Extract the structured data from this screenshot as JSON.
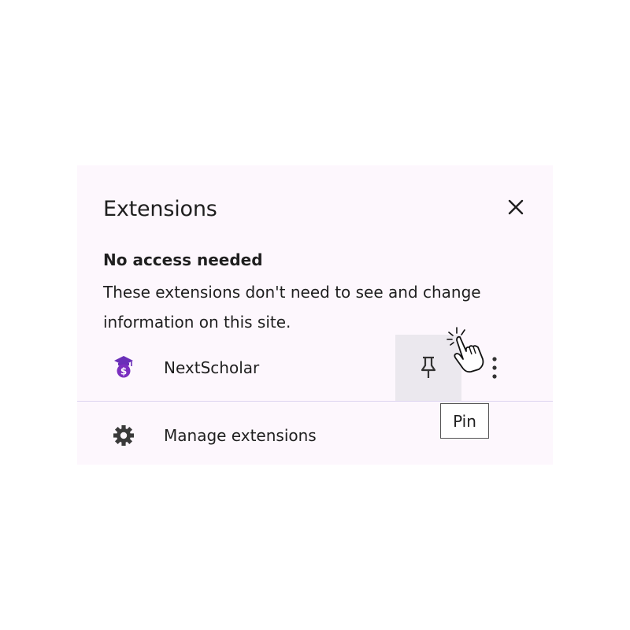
{
  "panel": {
    "title": "Extensions",
    "close_icon": "close-icon"
  },
  "section": {
    "heading": "No access needed",
    "description": "These extensions don't need to see and change information on this site."
  },
  "extensions": [
    {
      "name": "NextScholar",
      "icon": "graduation-cap-coin-icon",
      "pin_icon": "pin-icon",
      "more_icon": "more-vert-icon"
    }
  ],
  "manage": {
    "label": "Manage extensions",
    "icon": "gear-icon"
  },
  "tooltip": {
    "text": "Pin"
  },
  "colors": {
    "panel_bg": "#fdf7fd",
    "accent": "#7b2fc0",
    "hover_bg": "#ebe8ee"
  }
}
